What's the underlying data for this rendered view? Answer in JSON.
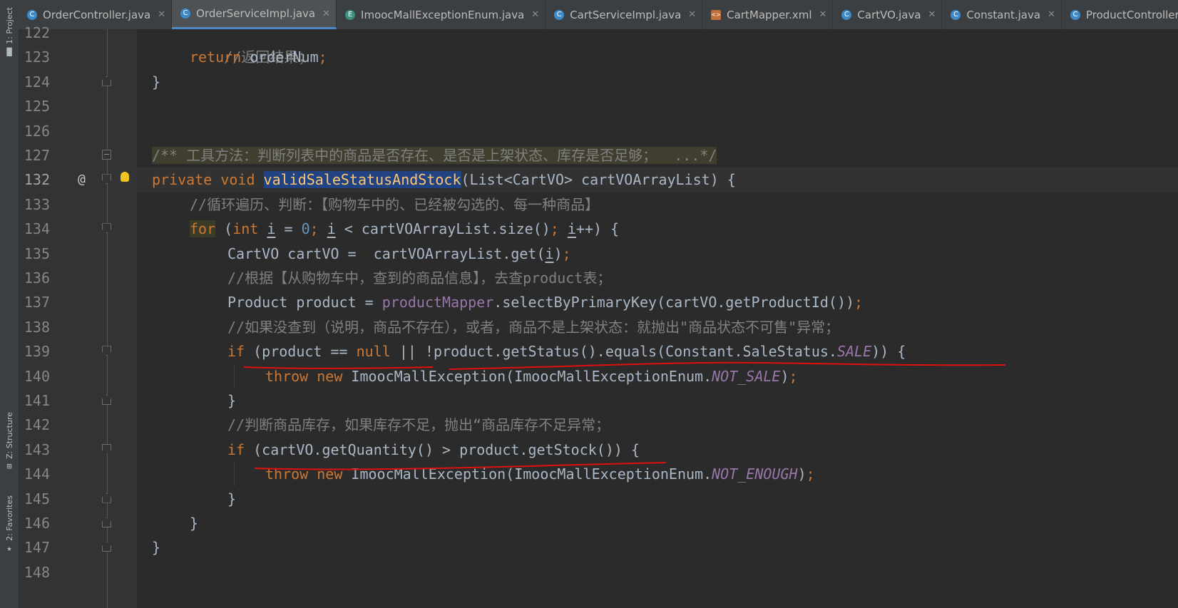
{
  "toolstrip": {
    "project_label": "1: Project",
    "structure_label": "Z: Structure",
    "favorites_label": "2: Favorites"
  },
  "tabs": [
    {
      "label": "OrderController.java",
      "icon": "class-icon",
      "active": false
    },
    {
      "label": "OrderServiceImpl.java",
      "icon": "class-icon",
      "active": true
    },
    {
      "label": "ImoocMallExceptionEnum.java",
      "icon": "enum-icon",
      "active": false
    },
    {
      "label": "CartServiceImpl.java",
      "icon": "class-icon",
      "active": false
    },
    {
      "label": "CartMapper.xml",
      "icon": "xml-icon",
      "active": false
    },
    {
      "label": "CartVO.java",
      "icon": "class-icon",
      "active": false
    },
    {
      "label": "Constant.java",
      "icon": "class-icon",
      "active": false
    },
    {
      "label": "ProductController.java",
      "icon": "class-icon",
      "active": false
    }
  ],
  "gutter": {
    "line_numbers": [
      "122",
      "123",
      "124",
      "125",
      "126",
      "127",
      "132",
      "133",
      "134",
      "135",
      "136",
      "137",
      "138",
      "139",
      "140",
      "141",
      "142",
      "143",
      "144",
      "145",
      "146",
      "147",
      "148"
    ]
  },
  "code": {
    "l122": "//返回结果；",
    "l123_kw": "return",
    "l123_rest": " orderNum",
    "l124": "}",
    "l127": "/** 工具方法：判断列表中的商品是否存在、是否是上架状态、库存是否足够；  ...*/",
    "l132_kw": "private void",
    "l132_name": "validSaleStatusAndStock",
    "l132_rest": "(List<CartVO> cartVOArrayList) {",
    "l133": "//循环遍历、判断：【购物车中的、已经被勾选的、每一种商品】",
    "l134_for": "for",
    "l134_a": " (",
    "l134_int": "int",
    "l134_i1": "i",
    "l134_eq": " = ",
    "l134_zero": "0",
    "l134_semi1": ";",
    "l134_i2": "i",
    "l134_mid": " < cartVOArrayList.size()",
    "l134_semi2": ";",
    "l134_i3": "i",
    "l134_end": "++) {",
    "l135_a": "CartVO cartVO =  cartVOArrayList.get(",
    "l135_i": "i",
    "l135_b": ")",
    "l136": "//根据【从购物车中，查到的商品信息】，去查product表；",
    "l137_a": "Product product = ",
    "l137_field": "productMapper",
    "l137_b": ".selectByPrimaryKey(cartVO.getProductId())",
    "l138": "//如果没查到（说明，商品不存在），或者，商品不是上架状态：就抛出\"商品状态不可售\"异常；",
    "l139_if": "if",
    "l139_a": " (product == ",
    "l139_null": "null",
    "l139_b": " || !product.getStatus().equals(Constant.SaleStatus.",
    "l139_sale": "SALE",
    "l139_c": ")) {",
    "l140_throw": "throw new",
    "l140_a": " ImoocMallException(ImoocMallExceptionEnum.",
    "l140_const": "NOT_SALE",
    "l140_b": ")",
    "l141": "}",
    "l142": "//判断商品库存，如果库存不足，抛出“商品库存不足异常；",
    "l143_if": "if",
    "l143_a": " (cartVO.getQuantity() > product.getStock()) {",
    "l144_throw": "throw new",
    "l144_a": " ImoocMallException(ImoocMallExceptionEnum.",
    "l144_const": "NOT_ENOUGH",
    "l144_b": ")",
    "l145": "}",
    "l146": "}",
    "l147": "}",
    "semicolon": ";"
  },
  "colors": {
    "keyword": "#cc7832",
    "comment": "#808080",
    "field": "#9876aa",
    "number": "#6897bb",
    "annotation_red": "#e01010"
  }
}
